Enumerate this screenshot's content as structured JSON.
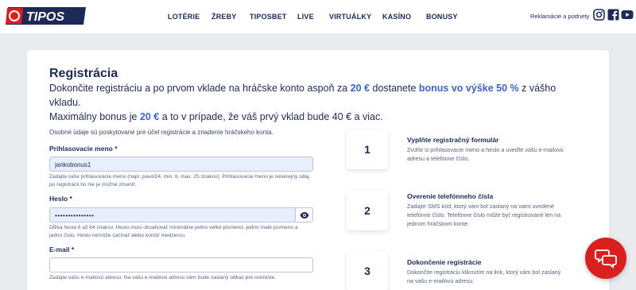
{
  "header": {
    "logo_text": "TIPOS",
    "nav": [
      "LOTÉRIE",
      "ŽREBY",
      "TIPOSBET",
      "LIVE",
      "VIRTUÁLKY",
      "KASÍNO",
      "BONUSY"
    ],
    "complaints_link": "Reklamácie a podnety",
    "social_icons": [
      "instagram-icon",
      "facebook-icon",
      "youtube-icon"
    ]
  },
  "registration": {
    "title": "Registrácia",
    "intro": {
      "part1": "Dokončite registráciu a po prvom vklade na hráčske konto aspoň za ",
      "amount1": "20 €",
      "part2": " dostanete ",
      "bonus": "bonus vo výške 50 %",
      "part3": " z vášho vkladu.",
      "part4": "Maximálny bonus je ",
      "amount2": "20 €",
      "part5": " a to v prípade, že váš prvý vklad bude 40 € a viac."
    },
    "personal_note": "Osobné údaje sú poskytované pre účel registrácie a zriadenie hráčskeho konta.",
    "username": {
      "label": "Prihlasovacie meno *",
      "value": "jankobonus1",
      "help": "Zadajte vaše prihlasovacie meno (napr. pavol24, min. 6, max. 25 znakov). Prihlasovacie meno je neverejný údaj, po registrácii ho nie je možné zmeniť."
    },
    "password": {
      "label": "Heslo *",
      "value": "•••••••••••••••",
      "help": "Dĺžka hesla 6 až 64 znakov. Heslo musí obsahovať minimálne jedno veľké písmeno, jedno malé písmeno a jedno číslo. Heslo nemôže začínať alebo končiť medzerou."
    },
    "email": {
      "label": "E-mail *",
      "value": "",
      "help": "Zadajte vašu e-mailovú adresu. Na vašu e-mailovú adresu vám bude zaslaný odkaz  pre overenie."
    }
  },
  "steps": [
    {
      "number": "1",
      "title": "Vyplňte registračný formulár",
      "desc": "Zvoľte si prihlasovacie meno a heslo a uveďte vašu e-mailovú adresu a telefónne číslo."
    },
    {
      "number": "2",
      "title": "Overenie telefónneho čísla",
      "desc": "Zadajte SMS kód, ktorý vám bol zaslaný na vami uvedené telefónne číslo. Telefónne číslo môže byť registrované len na jednom hráčskom konte."
    },
    {
      "number": "3",
      "title": "Dokončenie registrácie",
      "desc": "Dokončite registráciu kliknutím na link, ktorý vám bol zaslaný na vašu e-mailovú adresu."
    }
  ],
  "colors": {
    "brand_navy": "#1c2a55",
    "brand_red": "#d9201f",
    "highlight_blue": "#3c63c7"
  }
}
